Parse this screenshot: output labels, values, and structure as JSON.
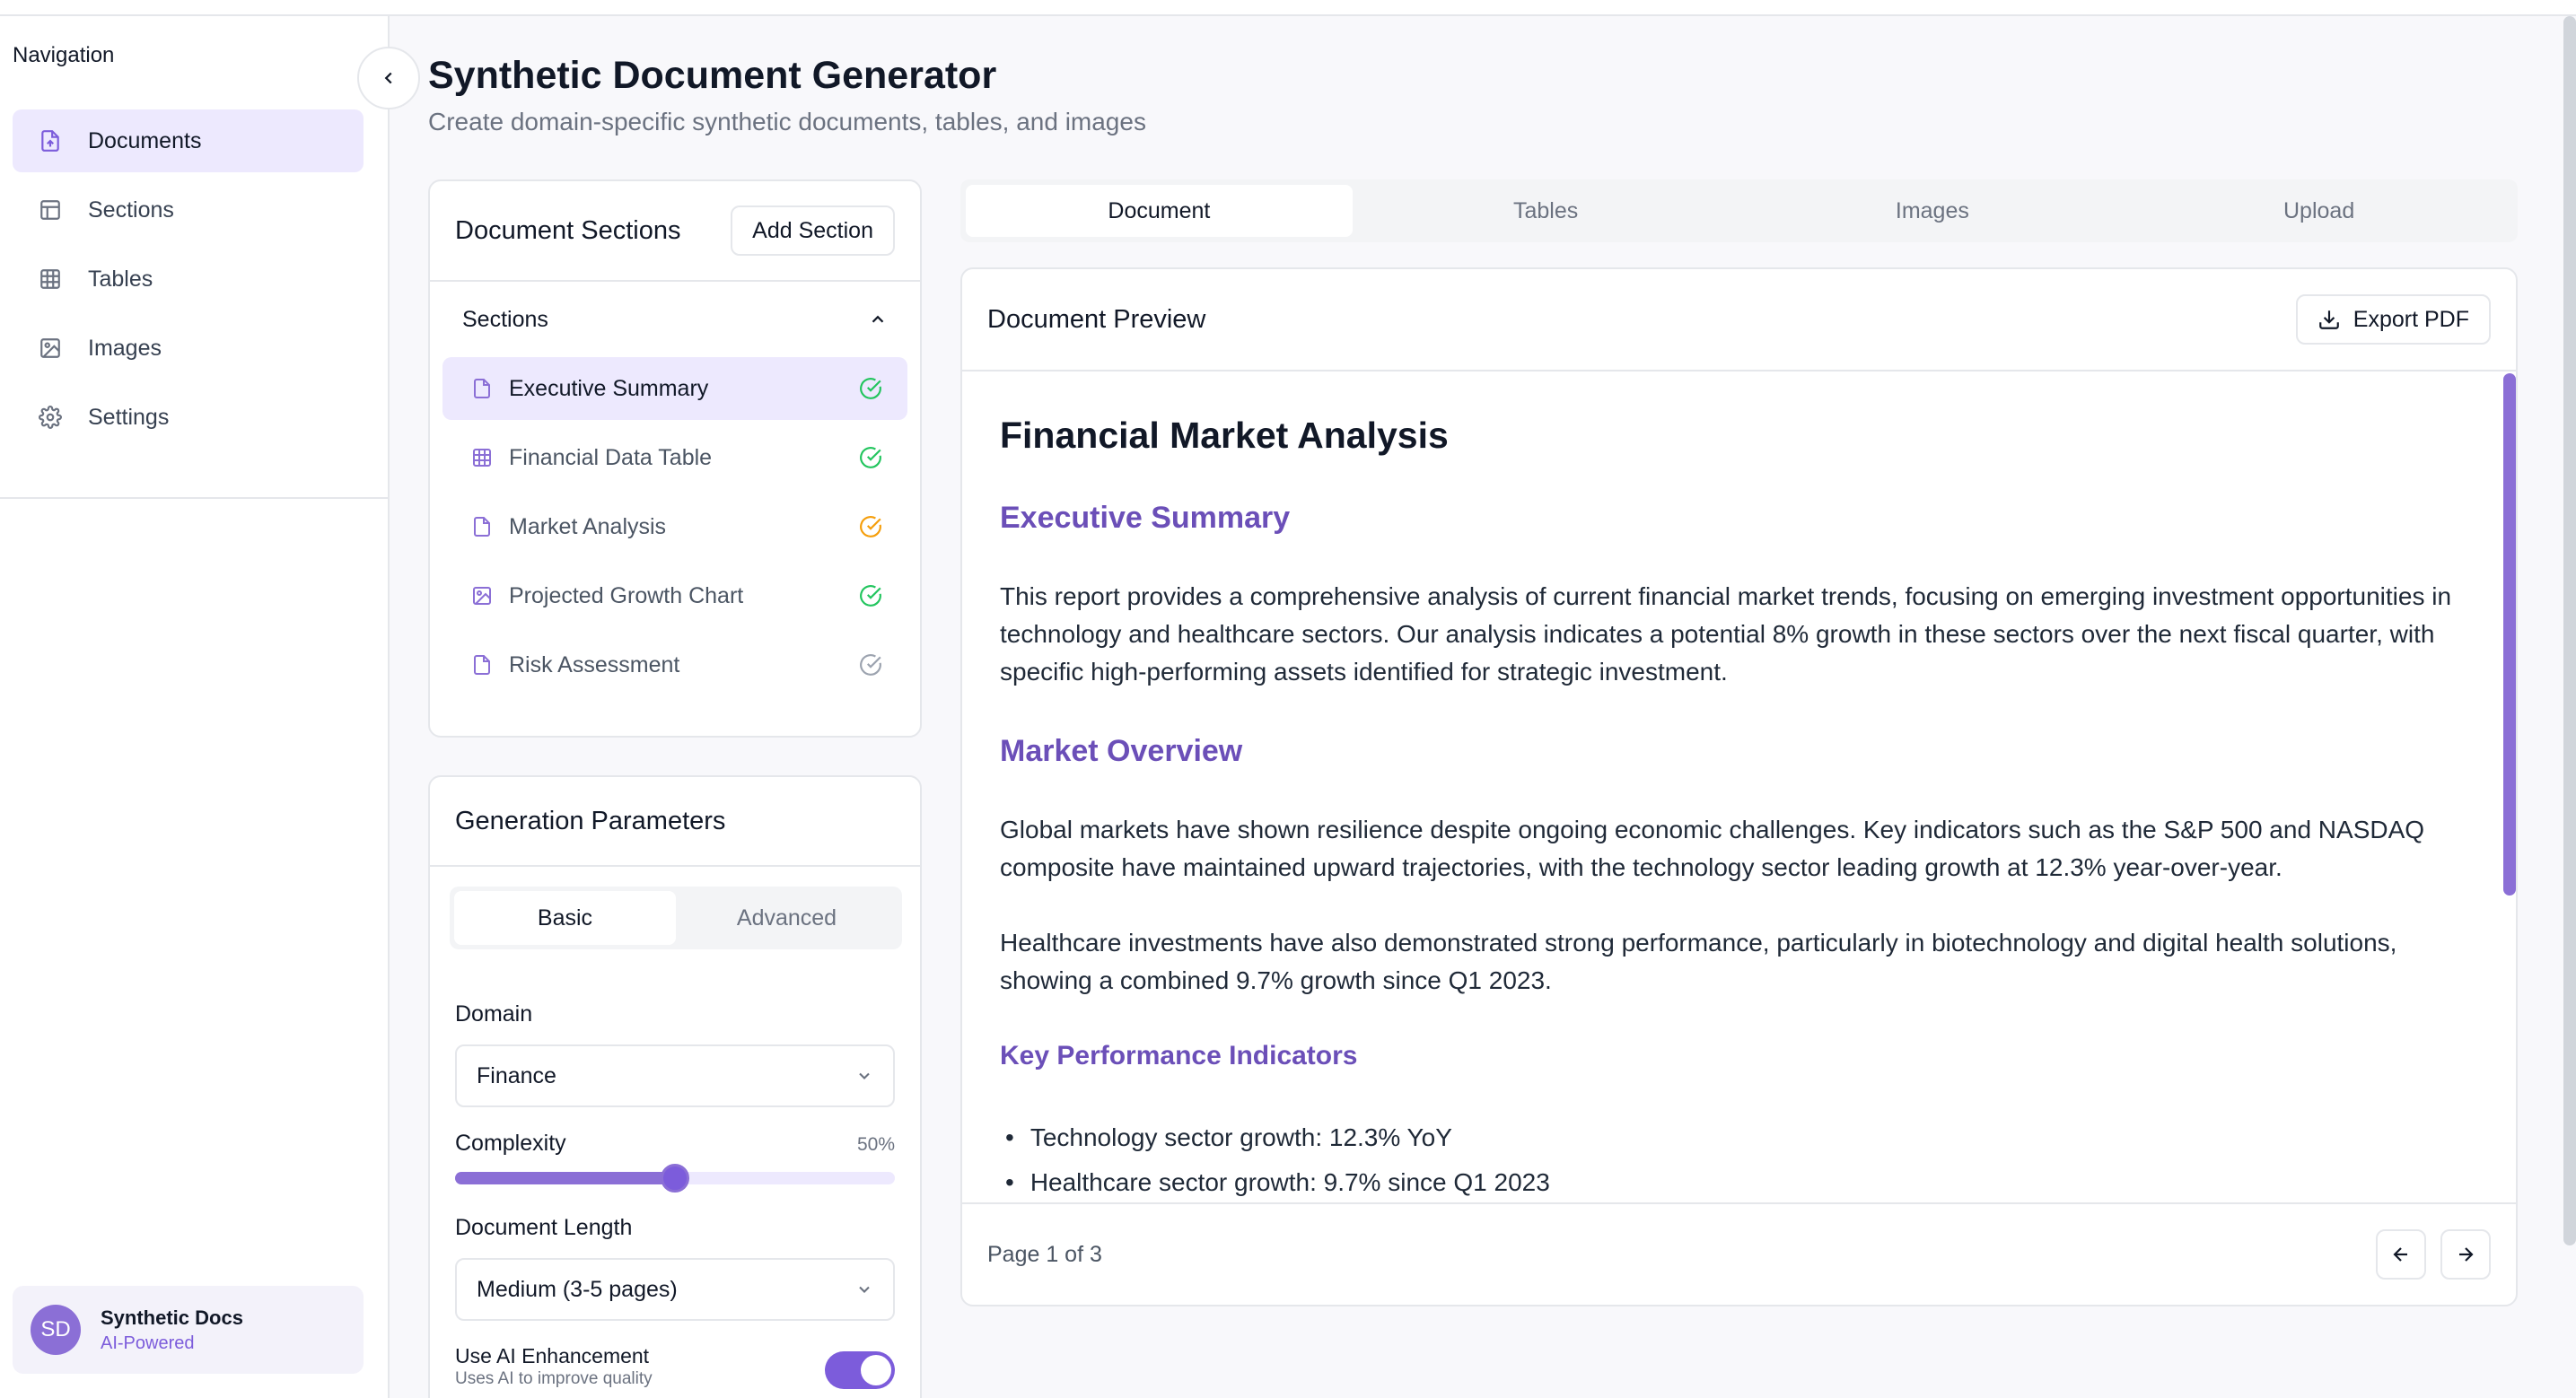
{
  "sidebar": {
    "title": "Navigation",
    "items": [
      {
        "label": "Documents",
        "icon": "file-icon"
      },
      {
        "label": "Sections",
        "icon": "layout-icon"
      },
      {
        "label": "Tables",
        "icon": "table-icon"
      },
      {
        "label": "Images",
        "icon": "image-icon"
      },
      {
        "label": "Settings",
        "icon": "gear-icon"
      }
    ],
    "profile": {
      "initials": "SD",
      "name": "Synthetic Docs",
      "subtitle": "AI-Powered"
    }
  },
  "header": {
    "title": "Synthetic Document Generator",
    "subtitle": "Create domain-specific synthetic documents, tables, and images"
  },
  "sections_card": {
    "title": "Document Sections",
    "add_button": "Add Section",
    "group_label": "Sections",
    "items": [
      {
        "label": "Executive Summary",
        "icon": "file-icon",
        "status": "complete"
      },
      {
        "label": "Financial Data Table",
        "icon": "table-icon",
        "status": "complete"
      },
      {
        "label": "Market Analysis",
        "icon": "file-icon",
        "status": "in-progress"
      },
      {
        "label": "Projected Growth Chart",
        "icon": "image-icon",
        "status": "complete"
      },
      {
        "label": "Risk Assessment",
        "icon": "file-icon",
        "status": "pending"
      }
    ]
  },
  "params": {
    "title": "Generation Parameters",
    "tabs": [
      "Basic",
      "Advanced"
    ],
    "domain_label": "Domain",
    "domain_value": "Finance",
    "complexity_label": "Complexity",
    "complexity_value": "50%",
    "complexity_fraction": 0.5,
    "length_label": "Document Length",
    "length_value": "Medium (3-5 pages)",
    "ai_label": "Use AI Enhancement",
    "ai_hint": "Uses AI to improve quality",
    "ai_enabled": true
  },
  "main_tabs": [
    "Document",
    "Tables",
    "Images",
    "Upload"
  ],
  "preview": {
    "title": "Document Preview",
    "export_button": "Export PDF",
    "doc_title": "Financial Market Analysis",
    "h_exec": "Executive Summary",
    "p_exec": "This report provides a comprehensive analysis of current financial market trends, focusing on emerging investment opportunities in technology and healthcare sectors. Our analysis indicates a potential 8% growth in these sectors over the next fiscal quarter, with specific high-performing assets identified for strategic investment.",
    "h_market": "Market Overview",
    "p_market1": "Global markets have shown resilience despite ongoing economic challenges. Key indicators such as the S&P 500 and NASDAQ composite have maintained upward trajectories, with the technology sector leading growth at 12.3% year-over-year.",
    "p_market2": "Healthcare investments have also demonstrated strong performance, particularly in biotechnology and digital health solutions, showing a combined 9.7% growth since Q1 2023.",
    "h_kpi": "Key Performance Indicators",
    "kpis": [
      "Technology sector growth: 12.3% YoY",
      "Healthcare sector growth: 9.7% since Q1 2023"
    ],
    "page_info": "Page 1 of 3"
  },
  "colors": {
    "accent": "#7c5cdb",
    "accent_light": "#ede9fe",
    "heading_purple": "#6b4fb8",
    "status_complete": "#22c55e",
    "status_in_progress": "#f59e0b",
    "status_pending": "#9ca3af"
  }
}
